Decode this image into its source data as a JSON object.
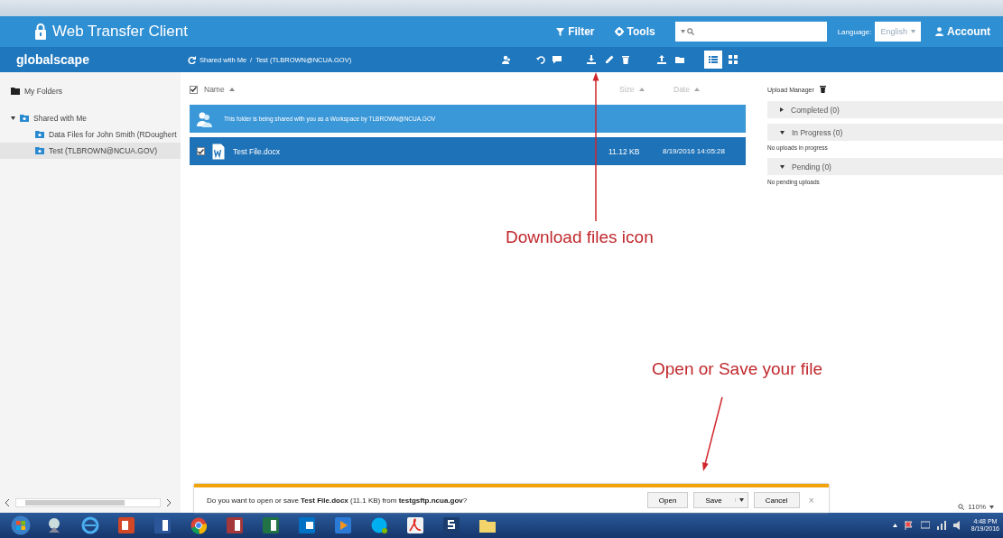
{
  "header": {
    "title": "Web Transfer Client",
    "filter": "Filter",
    "tools": "Tools",
    "language_label": "Language:",
    "language": "English",
    "account": "Account"
  },
  "toolbar": {
    "logo": "globalscape",
    "breadcrumb": [
      "Shared with Me",
      "Test (TLBROWN@NCUA.GOV)"
    ],
    "separator": "/",
    "view_toggles": [
      {
        "kind": "list",
        "selected": true
      },
      {
        "kind": "grid",
        "selected": false
      }
    ]
  },
  "sidebar": {
    "items": [
      {
        "label": "My Folders",
        "kind": "folder",
        "selected": false
      },
      {
        "label": "Shared with Me",
        "kind": "shared",
        "selected": false,
        "expanded": true,
        "children": [
          {
            "label": "Data Files for John Smith (RDoughert",
            "kind": "shared",
            "selected": false
          },
          {
            "label": "Test (TLBROWN@NCUA.GOV)",
            "kind": "shared",
            "selected": true
          }
        ]
      }
    ]
  },
  "file_list": {
    "select_all": {
      "checked": true
    },
    "columns": [
      "Name",
      "Size",
      "Date"
    ],
    "banner": "This folder is being shared with you as a Workspace by TLBROWN@NCUA.GOV",
    "rows": [
      {
        "name": "Test File.docx",
        "size": "11.12 KB",
        "date": "8/19/2016 14:05:28",
        "checked": true,
        "selected": true
      }
    ]
  },
  "upload_manager": {
    "title": "Upload Manager",
    "sections": [
      {
        "label": "Completed (0)",
        "expanded": false
      },
      {
        "label": "In Progress (0)",
        "expanded": true,
        "note": "No uploads in progress"
      },
      {
        "label": "Pending (0)",
        "expanded": true,
        "note": "No pending uploads"
      }
    ]
  },
  "annotations": [
    {
      "text": "Download files icon"
    },
    {
      "text": "Open or Save your file"
    }
  ],
  "notification": {
    "message": "Do you want to open or save **Test File.docx** (11.1 KB) from **testgsftp.ncua.gov**?",
    "buttons": [
      "Open",
      "Save",
      "Cancel"
    ],
    "close": "×"
  },
  "zoom": "110%",
  "taskbar": {
    "apps": [
      {
        "kind": "network"
      },
      {
        "kind": "browser"
      },
      {
        "kind": "slides"
      },
      {
        "kind": "doc"
      },
      {
        "kind": "chrome"
      },
      {
        "kind": "database"
      },
      {
        "kind": "sheet"
      },
      {
        "kind": "mail"
      },
      {
        "kind": "media"
      },
      {
        "kind": "chat"
      },
      {
        "kind": "pdf"
      },
      {
        "kind": "sftp"
      },
      {
        "kind": "folder"
      }
    ],
    "time": "4:48 PM",
    "date": "8/19/2016"
  }
}
